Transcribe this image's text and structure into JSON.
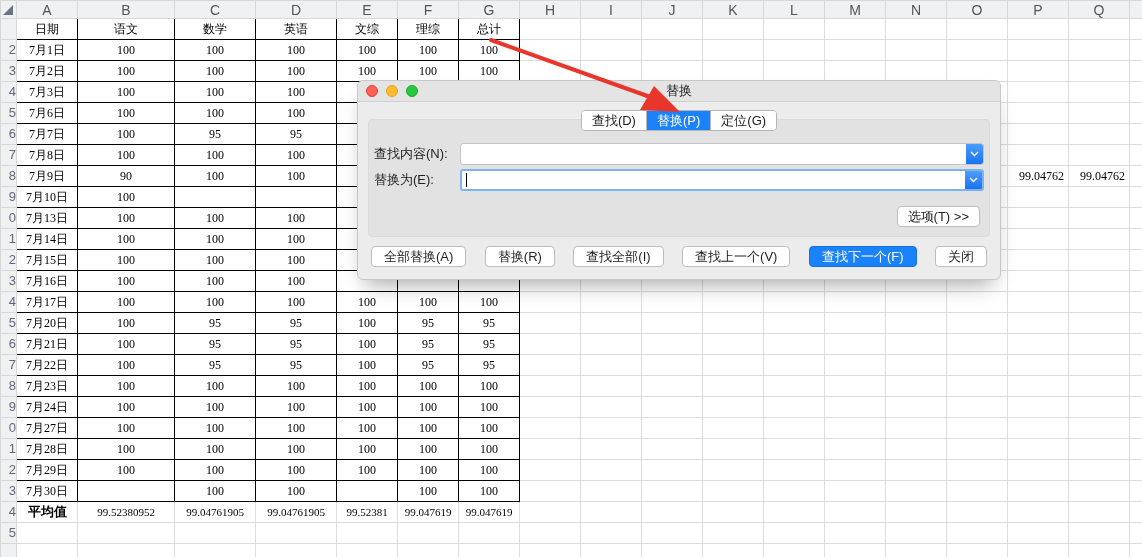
{
  "sheet": {
    "columns": [
      "A",
      "B",
      "C",
      "D",
      "E",
      "F",
      "G",
      "H",
      "I",
      "J",
      "K",
      "L",
      "M",
      "N",
      "O",
      "P",
      "Q"
    ],
    "rows": [
      {
        "kind": "header",
        "cells": [
          "日期",
          "语文",
          "数学",
          "英语",
          "文综",
          "理综",
          "总计"
        ]
      },
      {
        "kind": "data",
        "number": "2",
        "cells": [
          "7月1日",
          "100",
          "100",
          "100",
          "100",
          "100",
          "100"
        ]
      },
      {
        "kind": "data",
        "number": "3",
        "cells": [
          "7月2日",
          "100",
          "100",
          "100",
          "100",
          "100",
          "100"
        ]
      },
      {
        "kind": "data",
        "number": "4",
        "cells": [
          "7月3日",
          "100",
          "100",
          "100"
        ]
      },
      {
        "kind": "data",
        "number": "5",
        "cells": [
          "7月6日",
          "100",
          "100",
          "100"
        ]
      },
      {
        "kind": "data",
        "number": "6",
        "cells": [
          "7月7日",
          "100",
          "95",
          "95"
        ]
      },
      {
        "kind": "data",
        "number": "7",
        "cells": [
          "7月8日",
          "100",
          "100",
          "100"
        ]
      },
      {
        "kind": "data",
        "number": "8",
        "cells": [
          "7月9日",
          "90",
          "100",
          "100"
        ],
        "extra": [
          "99.04762",
          "99.04762"
        ]
      },
      {
        "kind": "data",
        "number": "9",
        "cells": [
          "7月10日",
          "100",
          null,
          null
        ]
      },
      {
        "kind": "data",
        "number": "0",
        "cells": [
          "7月13日",
          "100",
          "100",
          "100"
        ]
      },
      {
        "kind": "data",
        "number": "1",
        "cells": [
          "7月14日",
          "100",
          "100",
          "100"
        ]
      },
      {
        "kind": "data",
        "number": "2",
        "cells": [
          "7月15日",
          "100",
          "100",
          "100"
        ]
      },
      {
        "kind": "data",
        "number": "3",
        "cells": [
          "7月16日",
          "100",
          "100",
          "100"
        ]
      },
      {
        "kind": "data",
        "number": "4",
        "cells": [
          "7月17日",
          "100",
          "100",
          "100",
          "100",
          "100",
          "100"
        ]
      },
      {
        "kind": "data",
        "number": "5",
        "cells": [
          "7月20日",
          "100",
          "95",
          "95",
          "100",
          "95",
          "95"
        ]
      },
      {
        "kind": "data",
        "number": "6",
        "cells": [
          "7月21日",
          "100",
          "95",
          "95",
          "100",
          "95",
          "95"
        ]
      },
      {
        "kind": "data",
        "number": "7",
        "cells": [
          "7月22日",
          "100",
          "95",
          "95",
          "100",
          "95",
          "95"
        ]
      },
      {
        "kind": "data",
        "number": "8",
        "cells": [
          "7月23日",
          "100",
          "100",
          "100",
          "100",
          "100",
          "100"
        ]
      },
      {
        "kind": "data",
        "number": "9",
        "cells": [
          "7月24日",
          "100",
          "100",
          "100",
          "100",
          "100",
          "100"
        ]
      },
      {
        "kind": "data",
        "number": "0",
        "cells": [
          "7月27日",
          "100",
          "100",
          "100",
          "100",
          "100",
          "100"
        ]
      },
      {
        "kind": "data",
        "number": "1",
        "cells": [
          "7月28日",
          "100",
          "100",
          "100",
          "100",
          "100",
          "100"
        ]
      },
      {
        "kind": "data",
        "number": "2",
        "cells": [
          "7月29日",
          "100",
          "100",
          "100",
          "100",
          "100",
          "100"
        ]
      },
      {
        "kind": "data",
        "number": "3",
        "cells": [
          "7月30日",
          null,
          "100",
          "100",
          null,
          "100",
          "100"
        ]
      },
      {
        "kind": "average",
        "number": "4",
        "cells": [
          "平均值",
          "99.52380952",
          "99.04761905",
          "99.04761905",
          "99.52381",
          "99.047619",
          "99.047619"
        ]
      },
      {
        "kind": "empty",
        "number": "5"
      },
      {
        "kind": "empty"
      }
    ]
  },
  "dialog": {
    "title": "替换",
    "tabs": [
      {
        "label": "查找(D)",
        "selected": false
      },
      {
        "label": "替换(P)",
        "selected": true
      },
      {
        "label": "定位(G)",
        "selected": false
      }
    ],
    "fields": [
      {
        "label": "查找内容(N):",
        "focused": false
      },
      {
        "label": "替换为(E):",
        "focused": true
      }
    ],
    "options_button": "选项(T) >>",
    "buttons": [
      {
        "label": "全部替换(A)",
        "default": false
      },
      {
        "label": "替换(R)",
        "default": false
      },
      {
        "label": "查找全部(I)",
        "default": false
      },
      {
        "label": "查找上一个(V)",
        "default": false
      },
      {
        "label": "查找下一个(F)",
        "default": true
      },
      {
        "label": "关闭",
        "default": false
      }
    ]
  }
}
